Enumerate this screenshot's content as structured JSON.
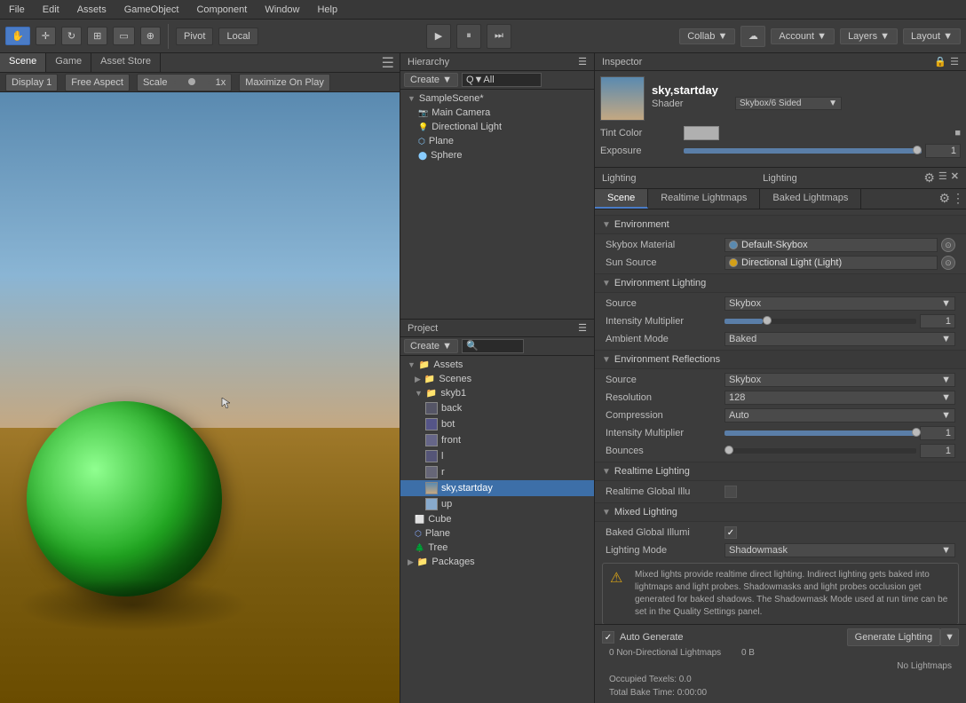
{
  "menubar": {
    "items": [
      "File",
      "Edit",
      "Assets",
      "GameObject",
      "Component",
      "Window",
      "Help"
    ]
  },
  "toolbar": {
    "tools": [
      "hand",
      "move",
      "rotate",
      "scale",
      "rect",
      "transform"
    ],
    "pivot_label": "Pivot",
    "local_label": "Local",
    "collab_label": "Collab ▼",
    "account_label": "Account ▼",
    "layers_label": "Layers ▼",
    "layout_label": "Layout ▼"
  },
  "scene_tabs": [
    "Scene",
    "Game",
    "Asset Store"
  ],
  "scene_tab_bar": {
    "display_label": "Display 1",
    "aspect_label": "Free Aspect",
    "scale_label": "Scale",
    "scale_value": "1x",
    "maximize_label": "Maximize On Play"
  },
  "hierarchy": {
    "title": "Hierarchy",
    "create_label": "Create ▼",
    "search_placeholder": "Q▼All",
    "scene_name": "SampleScene*",
    "items": [
      {
        "label": "Main Camera",
        "indent": 1,
        "icon": "camera"
      },
      {
        "label": "Directional Light",
        "indent": 1,
        "icon": "light"
      },
      {
        "label": "Plane",
        "indent": 1,
        "icon": "plane"
      },
      {
        "label": "Sphere",
        "indent": 1,
        "icon": "sphere"
      }
    ]
  },
  "project": {
    "title": "Project",
    "create_label": "Create ▼",
    "search_placeholder": "🔍",
    "items": [
      {
        "label": "Assets",
        "indent": 0,
        "type": "folder",
        "expanded": true
      },
      {
        "label": "Scenes",
        "indent": 1,
        "type": "folder",
        "expanded": false
      },
      {
        "label": "skyb1",
        "indent": 1,
        "type": "folder",
        "expanded": true
      },
      {
        "label": "back",
        "indent": 2,
        "type": "asset"
      },
      {
        "label": "bot",
        "indent": 2,
        "type": "asset"
      },
      {
        "label": "front",
        "indent": 2,
        "type": "asset"
      },
      {
        "label": "l",
        "indent": 2,
        "type": "asset"
      },
      {
        "label": "r",
        "indent": 2,
        "type": "asset"
      },
      {
        "label": "sky,startday",
        "indent": 2,
        "type": "asset",
        "selected": true
      },
      {
        "label": "up",
        "indent": 2,
        "type": "asset"
      },
      {
        "label": "Cube",
        "indent": 1,
        "type": "prefab"
      },
      {
        "label": "Plane",
        "indent": 1,
        "type": "prefab"
      },
      {
        "label": "Tree",
        "indent": 1,
        "type": "prefab"
      },
      {
        "label": "Packages",
        "indent": 0,
        "type": "folder",
        "expanded": false
      }
    ]
  },
  "inspector": {
    "title": "Inspector",
    "asset_name": "sky,startday",
    "shader_label": "Shader",
    "shader_value": "Skybox/6 Sided",
    "tint_label": "Tint Color",
    "exposure_label": "Exposure",
    "exposure_value": "1"
  },
  "lighting": {
    "title": "Lighting",
    "tabs": [
      "Scene",
      "Realtime Lightmaps",
      "Baked Lightmaps"
    ],
    "active_tab": "Scene",
    "environment_section": "Environment",
    "skybox_material_label": "Skybox Material",
    "skybox_material_value": "Default-Skybox",
    "sun_source_label": "Sun Source",
    "sun_source_value": "Directional Light (Light)",
    "env_lighting_section": "Environment Lighting",
    "source_label": "Source",
    "source_value": "Skybox",
    "intensity_label": "Intensity Multiplier",
    "intensity_value": "1",
    "ambient_label": "Ambient Mode",
    "ambient_value": "Baked",
    "env_reflections_section": "Environment Reflections",
    "refl_source_label": "Source",
    "refl_source_value": "Skybox",
    "resolution_label": "Resolution",
    "resolution_value": "128",
    "compression_label": "Compression",
    "compression_value": "Auto",
    "refl_intensity_label": "Intensity Multiplier",
    "refl_intensity_value": "1",
    "bounces_label": "Bounces",
    "bounces_value": "1",
    "realtime_section": "Realtime Lighting",
    "realtime_gi_label": "Realtime Global Illu",
    "mixed_section": "Mixed Lighting",
    "baked_gi_label": "Baked Global Illumi",
    "lighting_mode_label": "Lighting Mode",
    "lighting_mode_value": "Shadowmask",
    "info_text": "Mixed lights provide realtime direct lighting. Indirect lighting gets baked into lightmaps and light probes. Shadowmasks and light probes occlusion get generated for baked shadows. The Shadowmask Mode used at run time can be set in the Quality Settings panel.",
    "auto_generate_label": "Auto Generate",
    "generate_btn_label": "Generate Lighting",
    "stats": {
      "non_directional": "0 Non-Directional Lightmaps",
      "size": "0 B",
      "no_lightmaps": "No Lightmaps",
      "occupied_texels": "Occupied Texels: 0.0",
      "bake_time": "Total Bake Time: 0:00:00"
    }
  }
}
